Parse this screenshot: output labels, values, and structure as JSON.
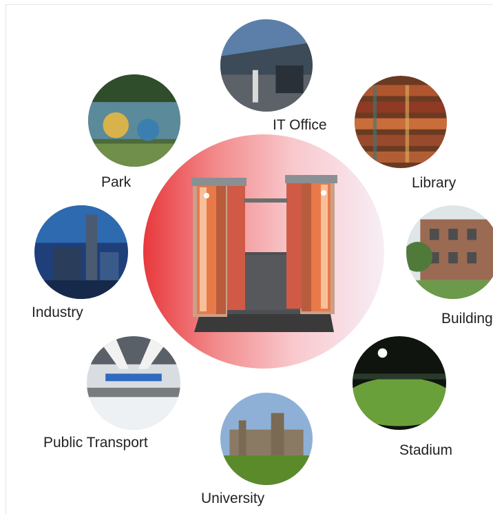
{
  "locations": [
    {
      "id": "it-office",
      "label": "IT Office"
    },
    {
      "id": "library",
      "label": "Library"
    },
    {
      "id": "park",
      "label": "Park"
    },
    {
      "id": "building",
      "label": "Building"
    },
    {
      "id": "industry",
      "label": "Industry"
    },
    {
      "id": "stadium",
      "label": "Stadium"
    },
    {
      "id": "public-transport",
      "label": "Public Transport"
    },
    {
      "id": "university",
      "label": "University"
    }
  ],
  "center": {
    "device": "turnstile-gate"
  },
  "colors": {
    "center_gradient_start": "#e8383d",
    "center_gradient_end": "#f7eef6"
  }
}
